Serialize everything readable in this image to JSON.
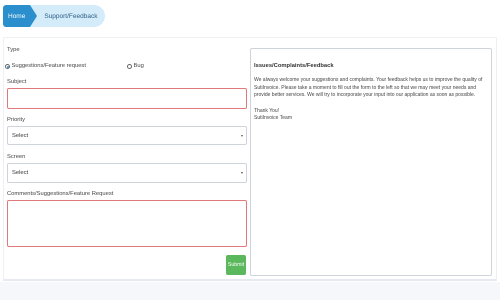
{
  "breadcrumb": {
    "home": "Home",
    "current": "Support/Feedback"
  },
  "form": {
    "type_label": "Type",
    "type_options": [
      {
        "label": "Suggestions/Feature request",
        "selected": true
      },
      {
        "label": "Bug",
        "selected": false
      }
    ],
    "subject_label": "Subject",
    "subject_value": "",
    "priority_label": "Priority",
    "priority_value": "Select",
    "screen_label": "Screen",
    "screen_value": "Select",
    "comments_label": "Comments/Suggestions/Feature Request",
    "comments_value": "",
    "submit_label": "Submit"
  },
  "info": {
    "title": "Issues/Complaints/Feedback",
    "body": "We always welcome your suggestions and complaints. Your feedback helps us to improve the quality of SutiInvoice. Please take a moment to fill out the form to the left so that we may meet your needs and provide better services. We will try to incorporate your input into our application as soon as possible.",
    "thanks": "Thank You!",
    "team": "SutiInvoice Team"
  },
  "colors": {
    "accent": "#2a8fcc",
    "breadcrumb_current_bg": "#d4ebfa",
    "required_border": "#e07a7a",
    "submit": "#5cb85c"
  }
}
